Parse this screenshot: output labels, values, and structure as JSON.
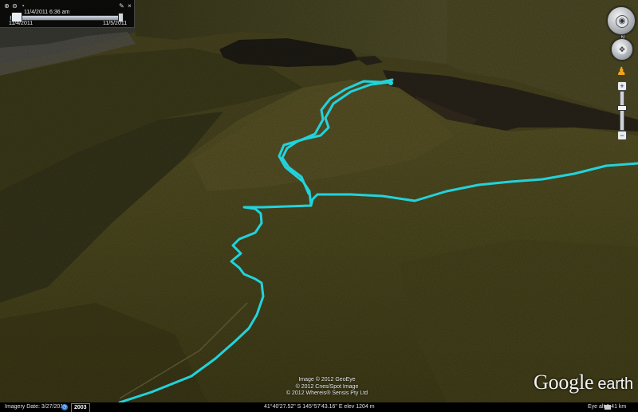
{
  "time_slider": {
    "current_time": "11/4/2011  6:36 am",
    "start_date": "11/4/2011",
    "end_date": "11/5/2011",
    "icons": [
      "zoom-in-icon",
      "zoom-out-icon",
      "clock-icon",
      "wrench-icon",
      "close-icon"
    ]
  },
  "navigation": {
    "north_label": "N",
    "icons": [
      "look-icon",
      "move-icon",
      "street-view-pegman-icon",
      "zoom-in-icon",
      "zoom-out-icon"
    ]
  },
  "attribution": [
    "Image © 2012 GeoEye",
    "© 2012 Cnes/Spot Image",
    "© 2012 Whereis® Sensis Pty Ltd"
  ],
  "logo": {
    "brand": "Google",
    "product": "earth"
  },
  "status_bar": {
    "imagery_date": "Imagery Date: 3/27/2011",
    "historical_year": "2003",
    "coordinates": "41°40'27.52\" S  145°57'43.16\" E  elev  1204 m",
    "eye_alt": "Eye alt    1.41 km"
  },
  "colors": {
    "track": "#22d3dc",
    "terrain": "#4b4a20",
    "lake": "#1e1b14"
  }
}
